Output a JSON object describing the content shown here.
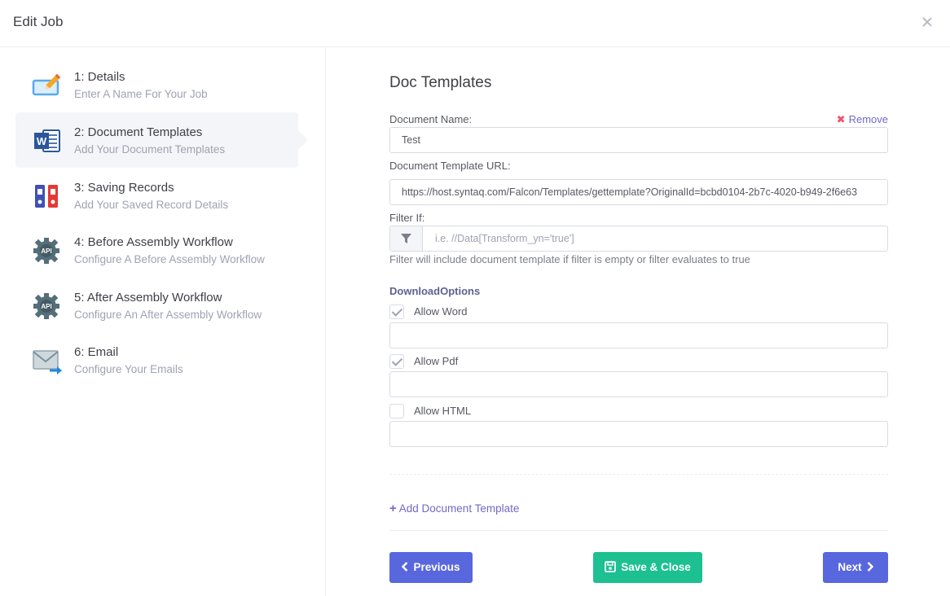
{
  "header": {
    "title": "Edit Job"
  },
  "steps": [
    {
      "title": "1: Details",
      "subtitle": "Enter A Name For Your Job",
      "icon": "edit-pencil-icon"
    },
    {
      "title": "2: Document Templates",
      "subtitle": "Add Your Document Templates",
      "icon": "word-document-icon"
    },
    {
      "title": "3: Saving Records",
      "subtitle": "Add Your Saved Record Details",
      "icon": "binders-icon"
    },
    {
      "title": "4: Before Assembly Workflow",
      "subtitle": "Configure A Before Assembly Workflow",
      "icon": "api-gear-icon"
    },
    {
      "title": "5: After Assembly Workflow",
      "subtitle": "Configure An After Assembly Workflow",
      "icon": "api-gear-icon"
    },
    {
      "title": "6: Email",
      "subtitle": "Configure Your Emails",
      "icon": "email-send-icon"
    }
  ],
  "active_step": 2,
  "main": {
    "heading": "Doc Templates",
    "document_name_label": "Document Name:",
    "remove_label": "Remove",
    "document_name_value": "Test",
    "template_url_label": "Document Template URL:",
    "template_url_value": "https://host.syntaq.com/Falcon/Templates/gettemplate?OriginalId=bcbd0104-2b7c-4020-b949-2f6e63",
    "filter_label": "Filter If:",
    "filter_placeholder": "i.e. //Data[Transform_yn='true']",
    "filter_value": "",
    "filter_help": "Filter will include document template if filter is empty or filter evaluates to true",
    "download_options_label": "DownloadOptions",
    "options": [
      {
        "label": "Allow Word",
        "checked": true,
        "value": ""
      },
      {
        "label": "Allow Pdf",
        "checked": true,
        "value": ""
      },
      {
        "label": "Allow HTML",
        "checked": false,
        "value": ""
      }
    ],
    "add_template_label": "Add Document Template"
  },
  "footer": {
    "previous_label": "Previous",
    "save_close_label": "Save & Close",
    "next_label": "Next"
  },
  "colors": {
    "primary": "#5867dd",
    "success": "#1cc091",
    "link": "#716aca",
    "danger": "#f4516c"
  }
}
